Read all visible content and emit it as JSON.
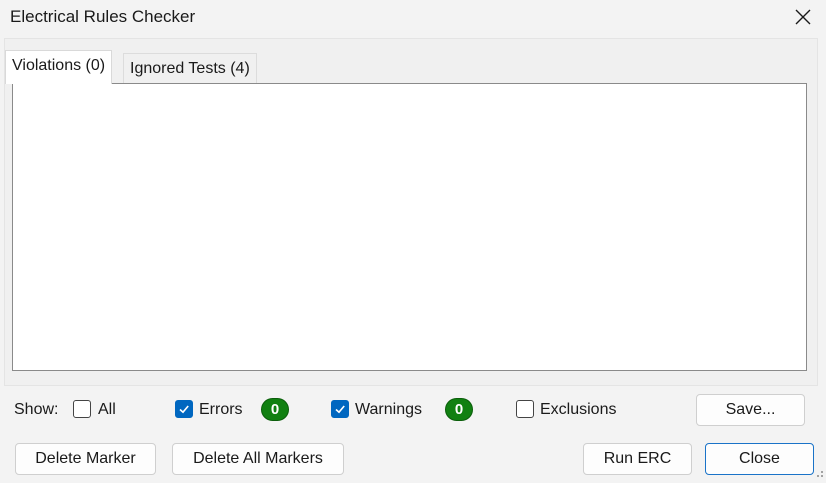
{
  "window": {
    "title": "Electrical Rules Checker"
  },
  "tabs": [
    {
      "label": "Violations (0)",
      "active": true
    },
    {
      "label": "Ignored Tests (4)",
      "active": false
    }
  ],
  "filters": {
    "show_label": "Show:",
    "all": {
      "label": "All",
      "checked": false
    },
    "errors": {
      "label": "Errors",
      "checked": true,
      "count": "0"
    },
    "warnings": {
      "label": "Warnings",
      "checked": true,
      "count": "0"
    },
    "exclusions": {
      "label": "Exclusions",
      "checked": false
    }
  },
  "buttons": {
    "save": "Save...",
    "delete_marker": "Delete Marker",
    "delete_all_markers": "Delete All Markers",
    "run_erc": "Run ERC",
    "close": "Close"
  },
  "colors": {
    "accent": "#0067c0",
    "badge": "#118011"
  }
}
